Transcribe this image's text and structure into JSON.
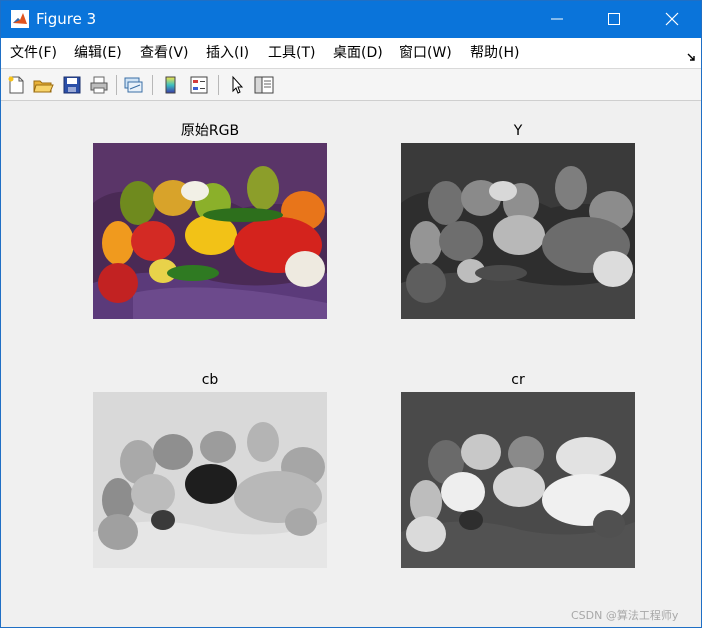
{
  "window": {
    "title": "Figure 3"
  },
  "menu": {
    "items": [
      {
        "id": "file",
        "label": "文件(F)"
      },
      {
        "id": "edit",
        "label": "编辑(E)"
      },
      {
        "id": "view",
        "label": "查看(V)"
      },
      {
        "id": "insert",
        "label": "插入(I)"
      },
      {
        "id": "tools",
        "label": "工具(T)"
      },
      {
        "id": "desktop",
        "label": "桌面(D)"
      },
      {
        "id": "window",
        "label": "窗口(W)"
      },
      {
        "id": "help",
        "label": "帮助(H)"
      }
    ]
  },
  "toolbar": {
    "icons": [
      "new-figure-icon",
      "open-file-icon",
      "save-icon",
      "print-icon",
      "link-plot-icon",
      "colorbar-icon",
      "legend-icon",
      "pointer-icon",
      "property-inspector-icon"
    ]
  },
  "subplots": [
    {
      "title": "原始RGB",
      "type": "rgb"
    },
    {
      "title": "Y",
      "type": "grayscale"
    },
    {
      "title": "cb",
      "type": "grayscale-light"
    },
    {
      "title": "cr",
      "type": "grayscale-dark"
    }
  ],
  "watermark": "CSDN @算法工程师y",
  "colors": {
    "titlebar": "#0a74da",
    "background": "#f0f0f0"
  }
}
